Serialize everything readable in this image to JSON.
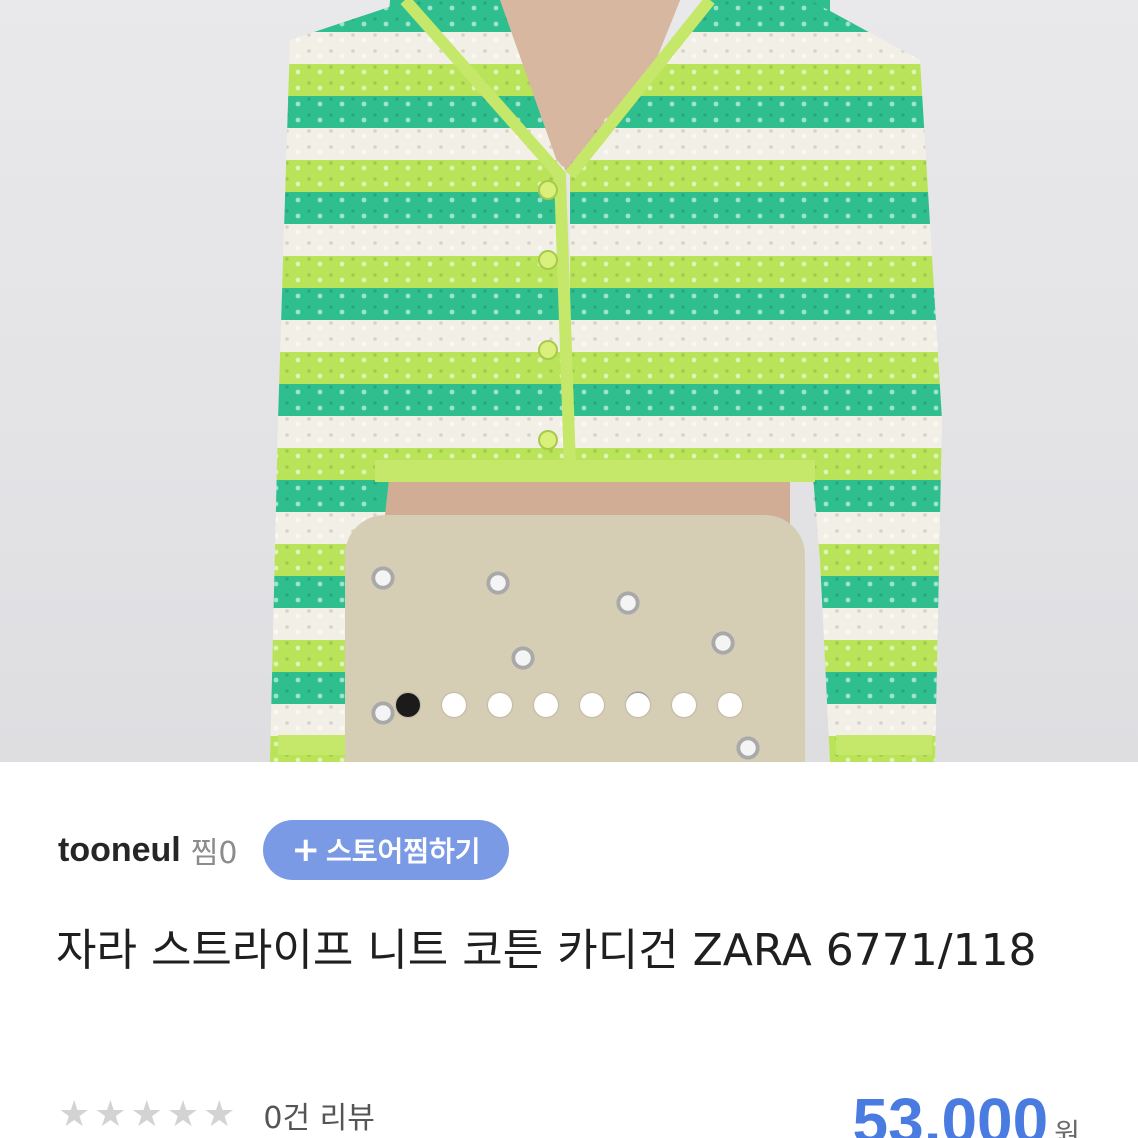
{
  "product_image": {
    "alt": "자라 스트라이프 니트 코튼 카디건",
    "carousel": {
      "count": 8,
      "active_index": 0
    }
  },
  "store": {
    "name": "tooneul",
    "likes": "찜0",
    "follow_label": "스토어찜하기",
    "follow_icon": "+"
  },
  "product": {
    "title": "자라 스트라이프 니트 코튼 카디건 ZARA 6771/118"
  },
  "review": {
    "rating": 0,
    "max_rating": 5,
    "count_label": "0건 리뷰"
  },
  "price": {
    "value": "53,000",
    "unit": "원"
  },
  "colors": {
    "accent": "#4a7be0",
    "follow_button": "#7b9ae6",
    "stripe_green": "#2fbf8f",
    "stripe_lime": "#b9e45a",
    "stripe_cream": "#f2f0e6"
  }
}
